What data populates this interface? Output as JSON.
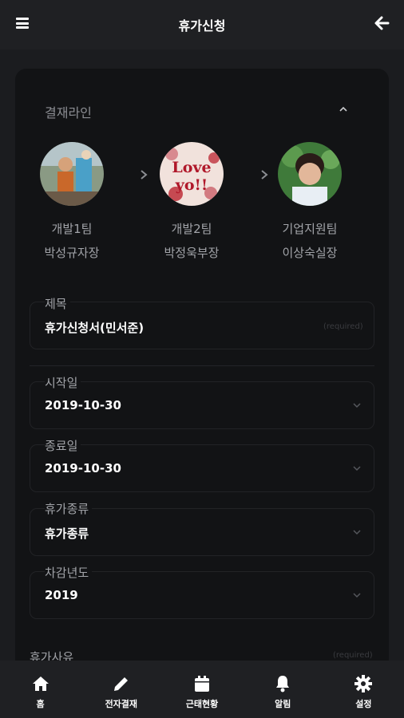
{
  "header": {
    "title": "휴가신청",
    "menu_icon": "hamburger-menu-icon",
    "back_icon": "arrow-left-icon"
  },
  "approval": {
    "label": "결재라인",
    "approvers": [
      {
        "team": "개발1팀",
        "name": "박성규자장",
        "avatar": "photo-child-outdoors"
      },
      {
        "team": "개발2팀",
        "name": "박정욱부장",
        "avatar": "photo-love-you-text"
      },
      {
        "team": "기업지원팀",
        "name": "이상숙실장",
        "avatar": "photo-woman-portrait"
      }
    ]
  },
  "form": {
    "subject": {
      "label": "제목",
      "value": "휴가신청서(민서준)",
      "hint": "(required)"
    },
    "start_date": {
      "label": "시작일",
      "value": "2019-10-30"
    },
    "end_date": {
      "label": "종료일",
      "value": "2019-10-30"
    },
    "leave_type": {
      "label": "휴가종류",
      "value": "휴가종류"
    },
    "deduct_year": {
      "label": "차감년도",
      "value": "2019"
    },
    "reason": {
      "label": "휴가사유",
      "hint": "(required)"
    }
  },
  "tabs": [
    {
      "label": "홈",
      "icon": "home-icon"
    },
    {
      "label": "전자결재",
      "icon": "pencil-icon"
    },
    {
      "label": "근태현황",
      "icon": "calendar-icon"
    },
    {
      "label": "알림",
      "icon": "bell-icon"
    },
    {
      "label": "설정",
      "icon": "gear-icon"
    }
  ],
  "colors": {
    "background": "#1b1c1f",
    "card": "#121315",
    "bar": "#1f2023",
    "text": "#ffffff",
    "muted": "#a2a4a9"
  }
}
